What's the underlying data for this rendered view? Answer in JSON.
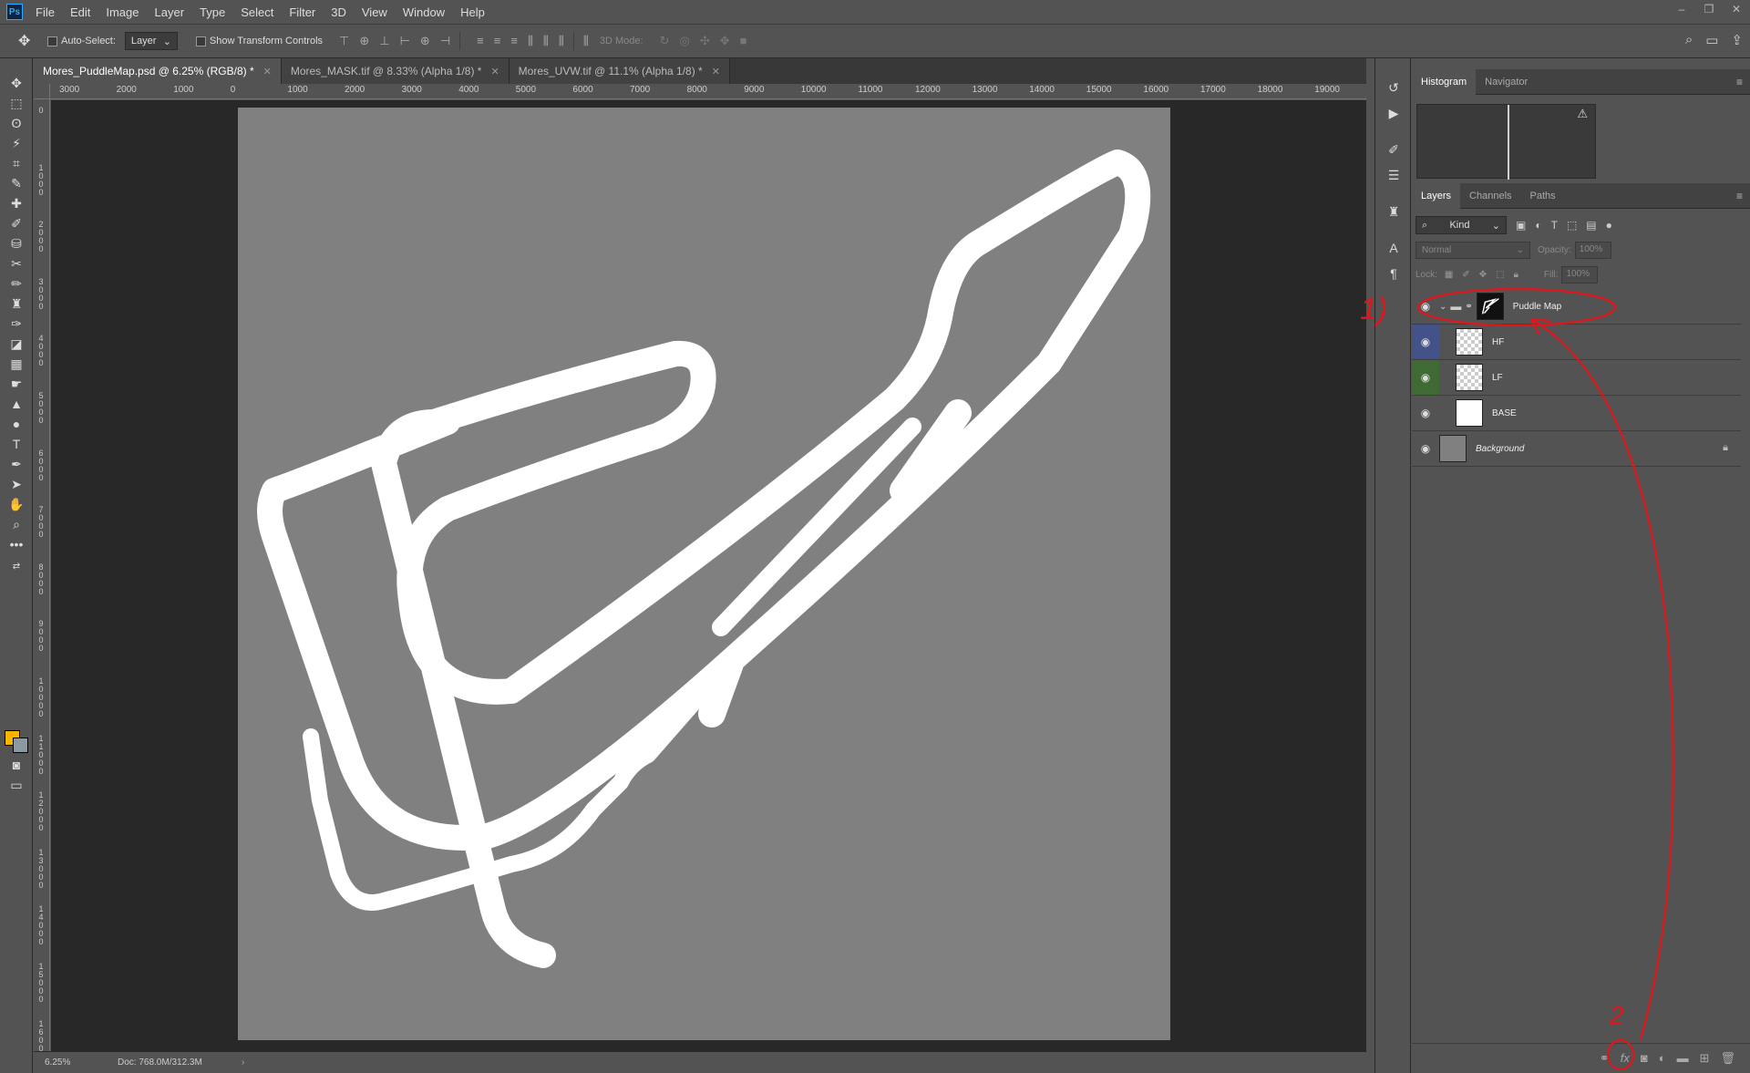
{
  "app": {
    "logo": "Ps"
  },
  "menu": [
    "File",
    "Edit",
    "Image",
    "Layer",
    "Type",
    "Select",
    "Filter",
    "3D",
    "View",
    "Window",
    "Help"
  ],
  "window_controls": [
    "–",
    "❐",
    "✕"
  ],
  "options": {
    "auto_select_label": "Auto-Select:",
    "auto_select_value": "Layer",
    "transform_label": "Show Transform Controls",
    "mode_3d_label": "3D Mode:"
  },
  "tabs": [
    {
      "label": "Mores_PuddleMap.psd @ 6.25% (RGB/8) *",
      "active": true
    },
    {
      "label": "Mores_MASK.tif @ 8.33% (Alpha 1/8) *",
      "active": false
    },
    {
      "label": "Mores_UVW.tif @ 11.1% (Alpha 1/8) *",
      "active": false
    }
  ],
  "ruler_h": [
    "3000",
    "2000",
    "1000",
    "0",
    "1000",
    "2000",
    "3000",
    "4000",
    "5000",
    "6000",
    "7000",
    "8000",
    "9000",
    "10000",
    "11000",
    "12000",
    "13000",
    "14000",
    "15000",
    "16000",
    "17000",
    "18000",
    "19000"
  ],
  "ruler_v": [
    "0",
    "1 0 0 0",
    "2 0 0 0",
    "3 0 0 0",
    "4 0 0 0",
    "5 0 0 0",
    "6 0 0 0",
    "7 0 0 0",
    "8 0 0 0",
    "9 0 0 0",
    "1 0 0 0 0",
    "1 1 0 0 0",
    "1 2 0 0 0",
    "1 3 0 0 0",
    "1 4 0 0 0",
    "1 5 0 0 0",
    "1 6 0 0 0"
  ],
  "status": {
    "zoom": "6.25%",
    "doc": "Doc: 768.0M/312.3M",
    "arrow": "›"
  },
  "histogram_panel": {
    "tabs": [
      "Histogram",
      "Navigator"
    ],
    "warning_icon": "⚠"
  },
  "layers_panel": {
    "tabs": [
      "Layers",
      "Channels",
      "Paths"
    ],
    "kind_label": "Kind",
    "blend_mode": "Normal",
    "opacity_label": "Opacity:",
    "opacity_value": "100%",
    "lock_label": "Lock:",
    "fill_label": "Fill:",
    "fill_value": "100%",
    "layers": [
      {
        "name": "Puddle Map",
        "type": "group",
        "color": ""
      },
      {
        "name": "HF",
        "type": "layer",
        "color": "#43538a"
      },
      {
        "name": "LF",
        "type": "layer",
        "color": "#3f6a33"
      },
      {
        "name": "BASE",
        "type": "layer",
        "color": ""
      },
      {
        "name": "Background",
        "type": "background",
        "color": ""
      }
    ]
  },
  "annotations": {
    "label_1": "1)",
    "label_2": "2"
  },
  "colors": {
    "foreground": "#f7b400",
    "background": "#8a9aa0",
    "canvas_gray": "#808080",
    "track": "#ffffff",
    "annotation": "#e0161b"
  }
}
